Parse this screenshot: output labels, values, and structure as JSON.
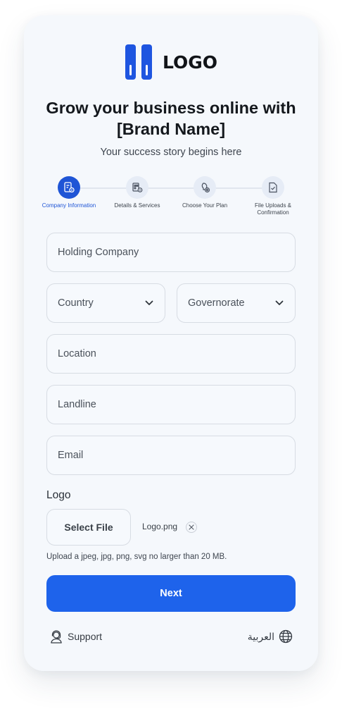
{
  "brand": {
    "logo_text": "LOGO",
    "logo_icon": "logo-mark-icon",
    "accent": "#1e63eb"
  },
  "header": {
    "title": "Grow your business online with [Brand Name]",
    "subtitle": "Your success story begins here"
  },
  "stepper": {
    "steps": [
      {
        "label": "Company Information",
        "icon": "company-info-icon",
        "active": true
      },
      {
        "label": "Details & Services",
        "icon": "details-services-icon",
        "active": false
      },
      {
        "label": "Choose Your Plan",
        "icon": "choose-plan-icon",
        "active": false
      },
      {
        "label": "File Uploads & Confirmation",
        "icon": "file-upload-icon",
        "active": false
      }
    ]
  },
  "form": {
    "holding_company": {
      "placeholder": "Holding Company",
      "value": ""
    },
    "country": {
      "placeholder": "Country",
      "value": ""
    },
    "governorate": {
      "placeholder": "Governorate",
      "value": ""
    },
    "location": {
      "placeholder": "Location",
      "value": ""
    },
    "landline": {
      "placeholder": "Landline",
      "value": ""
    },
    "email": {
      "placeholder": "Email",
      "value": ""
    }
  },
  "logo_upload": {
    "label": "Logo",
    "button_label": "Select File",
    "file_name": "Logo.png",
    "hint": "Upload a jpeg, jpg, png, svg no larger than 20 MB."
  },
  "actions": {
    "next_label": "Next"
  },
  "footer": {
    "support_label": "Support",
    "support_icon": "support-agent-icon",
    "language_label": "العربية",
    "language_icon": "globe-icon"
  }
}
